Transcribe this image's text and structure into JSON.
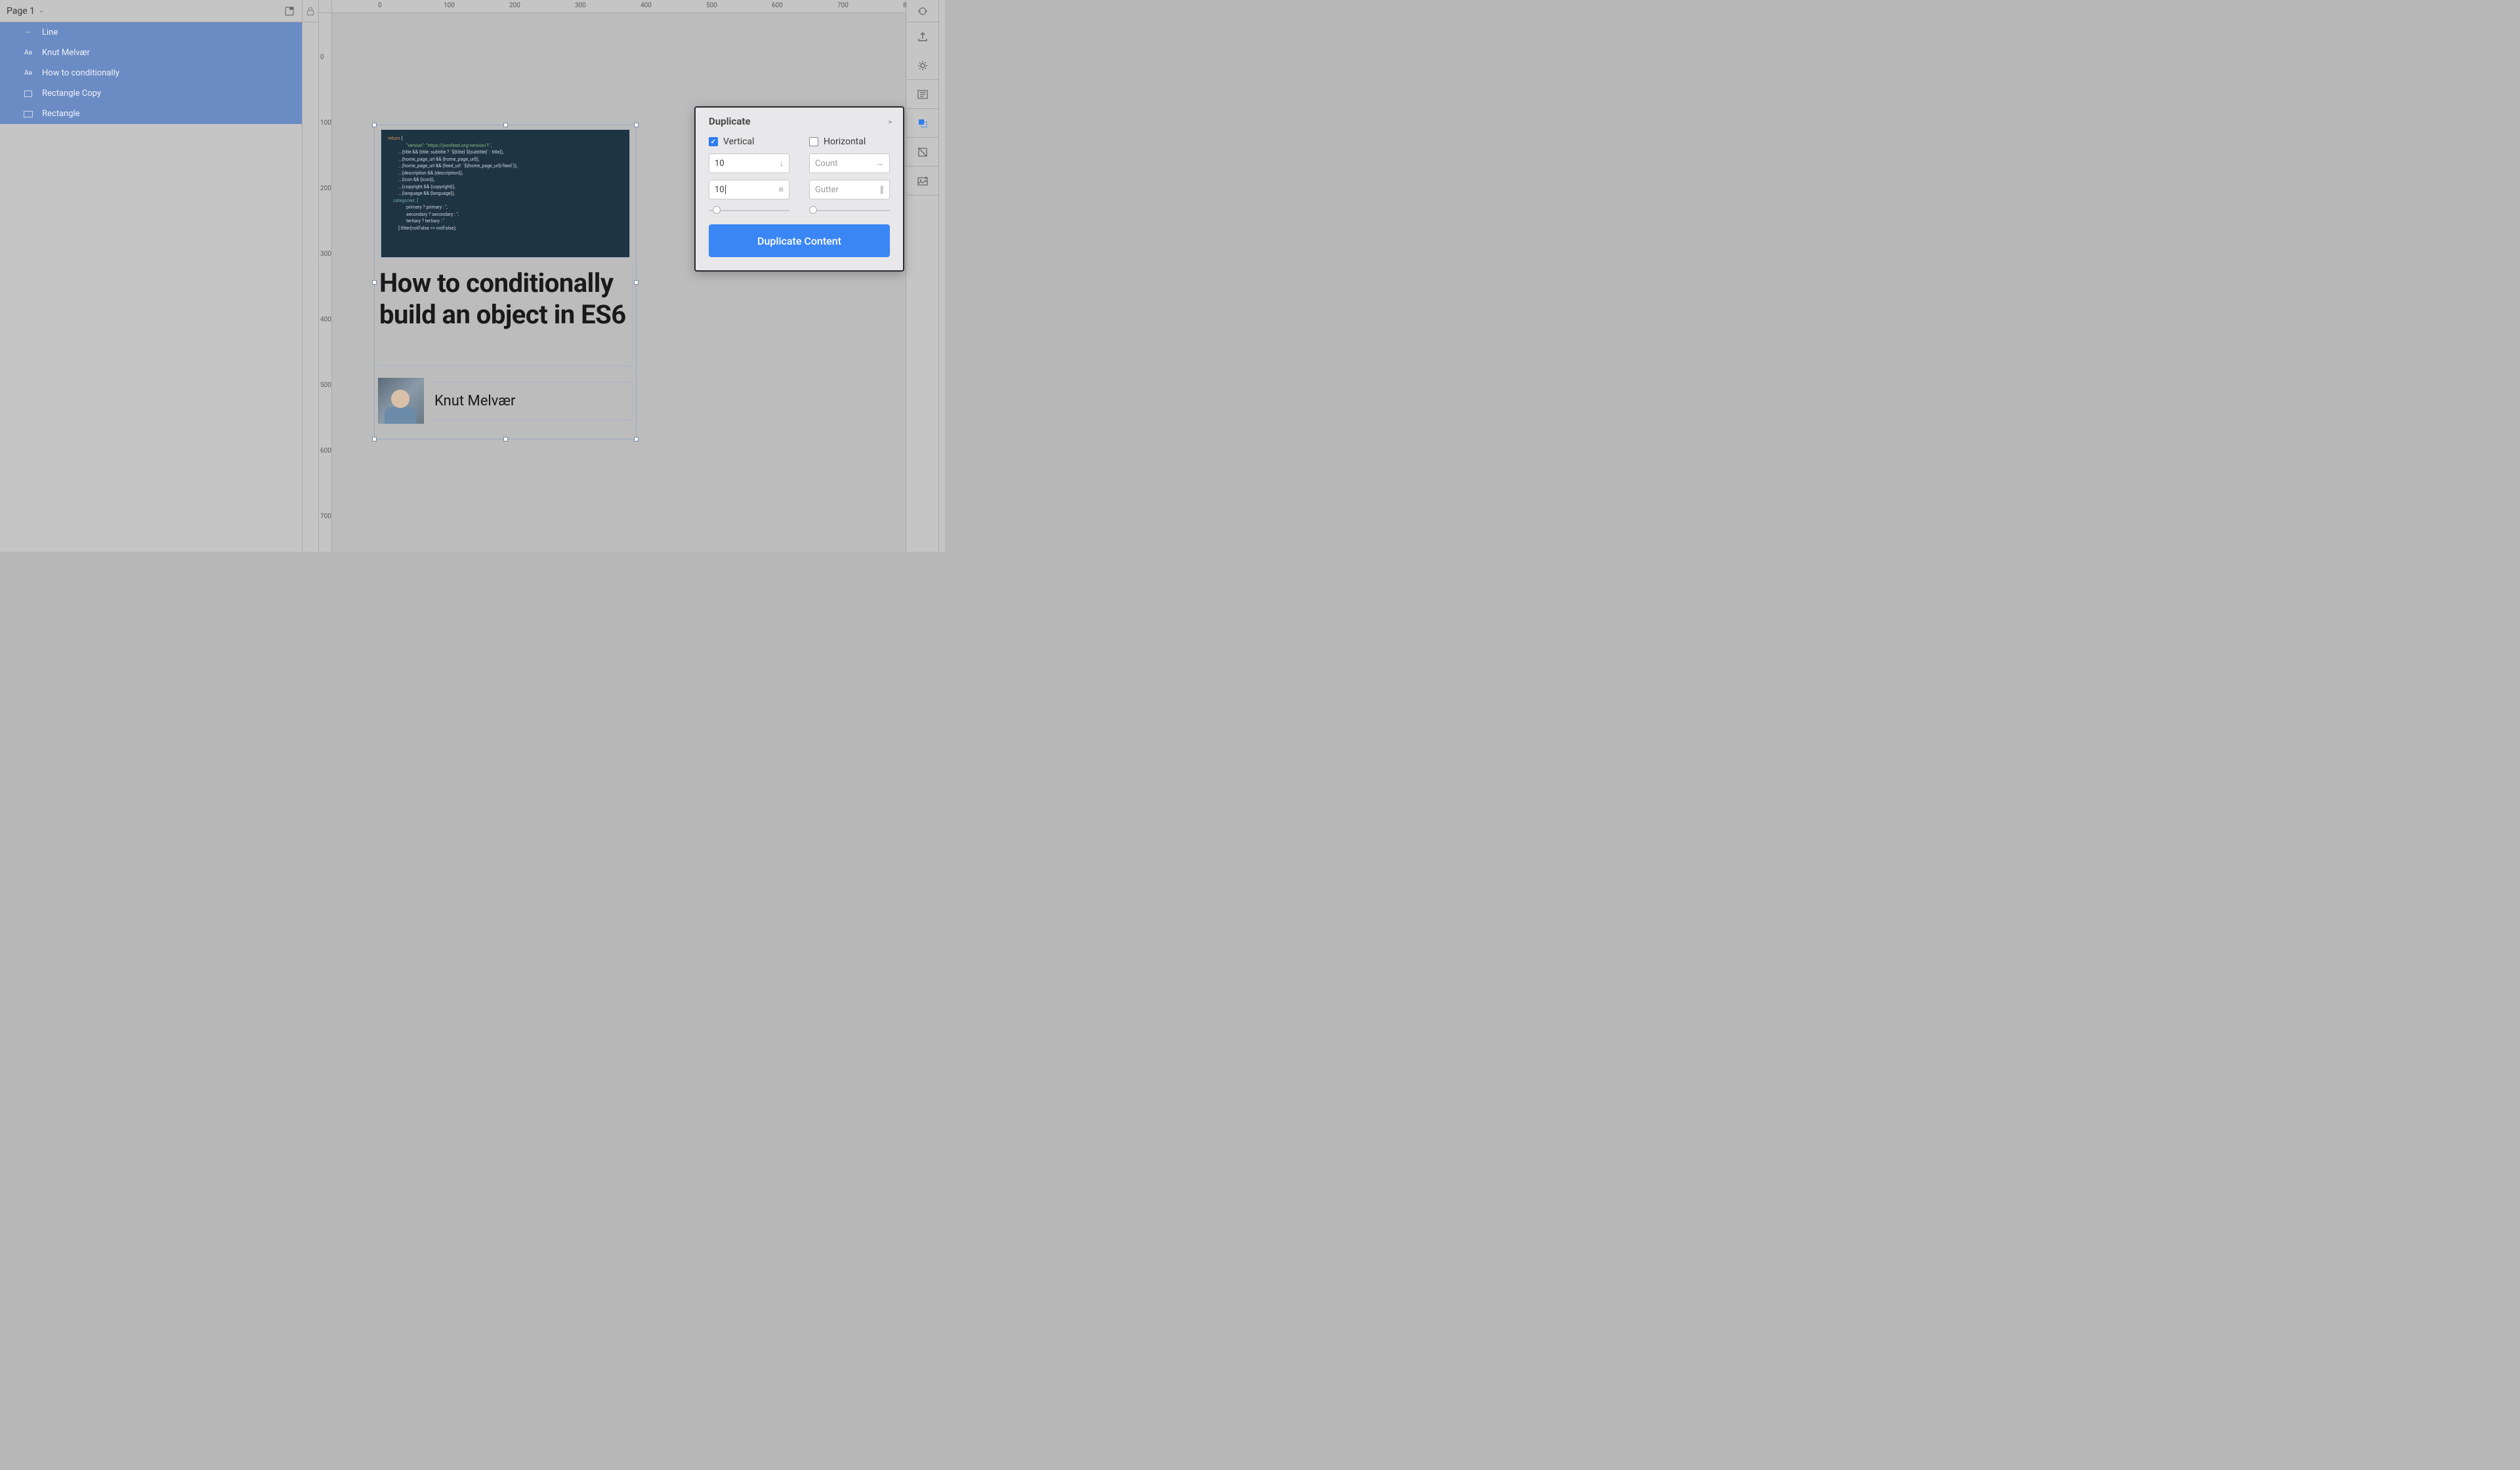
{
  "left": {
    "page_label": "Page 1",
    "layers": [
      {
        "icon": "line",
        "name": "Line"
      },
      {
        "icon": "text",
        "name": "Knut Melvær"
      },
      {
        "icon": "text",
        "name": "How to conditionally"
      },
      {
        "icon": "rect-outline",
        "name": "Rectangle Copy"
      },
      {
        "icon": "rect",
        "name": "Rectangle"
      }
    ]
  },
  "ruler": {
    "h": [
      "0",
      "100",
      "200",
      "300",
      "400",
      "500",
      "600",
      "700",
      "8"
    ],
    "v": [
      "0",
      "100",
      "200",
      "300",
      "400",
      "500",
      "600",
      "700"
    ]
  },
  "canvas": {
    "heading": "How to conditionally build an object in ES6",
    "author": "Knut Melvær",
    "code_lines": [
      "return {",
      "    \"version\": \"https://jsonfeed.org/version/1\",",
      "  ...(title && {title: subtitle ? `${title} ${subtitle}` : title}),",
      "  ...(home_page_url && {home_page_url}),",
      "  ...(home_page_url && {feed_url: `${home_page_url}/feed`}),",
      "  ...(description && {description}),",
      "  ...(icon && {icon}),",
      "  ...(copyright && {copyright}),",
      "  ...(language && {language}),",
      "categories: [",
      "    primary ? primary : '',",
      "    secondary ? secondary : '',",
      "    tertiary ? tertiary : ''",
      "  ].filter(notFalse => notFalse);"
    ]
  },
  "popover": {
    "title": "Duplicate",
    "vertical_label": "Vertical",
    "horizontal_label": "Horizontal",
    "vertical_checked": true,
    "horizontal_checked": false,
    "v_count": "10",
    "v_gutter": "10",
    "h_count_placeholder": "Count",
    "h_gutter_placeholder": "Gutter",
    "button": "Duplicate Content"
  }
}
